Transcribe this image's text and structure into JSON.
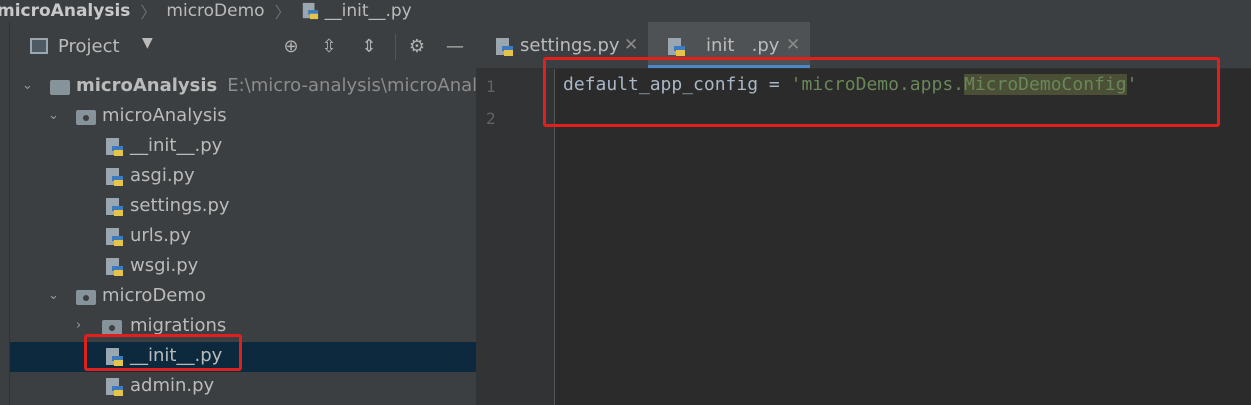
{
  "breadcrumb": {
    "root": "microAnalysis",
    "folder": "microDemo",
    "file": "__init__.py"
  },
  "project_panel": {
    "view_label": "Project",
    "icons": [
      "add-target-icon",
      "expand-all-icon",
      "collapse-all-icon",
      "gear-icon",
      "minimize-icon"
    ],
    "tree": [
      {
        "label": "microAnalysis",
        "path": "E:\\micro-analysis\\microAnalysis",
        "type": "root",
        "expanded": true
      },
      {
        "label": "microAnalysis",
        "type": "folder",
        "expanded": true
      },
      {
        "label": "__init__.py",
        "type": "python-file"
      },
      {
        "label": "asgi.py",
        "type": "python-file"
      },
      {
        "label": "settings.py",
        "type": "python-file"
      },
      {
        "label": "urls.py",
        "type": "python-file"
      },
      {
        "label": "wsgi.py",
        "type": "python-file"
      },
      {
        "label": "microDemo",
        "type": "folder",
        "expanded": true
      },
      {
        "label": "migrations",
        "type": "folder",
        "expanded": false
      },
      {
        "label": "__init__.py",
        "type": "python-file",
        "selected": true
      },
      {
        "label": "admin.py",
        "type": "python-file"
      }
    ]
  },
  "editor": {
    "tabs": [
      {
        "label": "settings.py",
        "active": false
      },
      {
        "label": "init   .py",
        "active": true
      }
    ],
    "line_numbers": [
      "1",
      "2"
    ],
    "code": {
      "var": "default_app_config",
      "op": " = ",
      "quote_open": "'",
      "str_body": "microDemo.apps.",
      "str_highlight": "MicroDemoConfig",
      "quote_close": "'"
    }
  },
  "colors": {
    "annotation_red": "#e0201c",
    "selection": "#0d293e",
    "string_green": "#6a8759"
  }
}
